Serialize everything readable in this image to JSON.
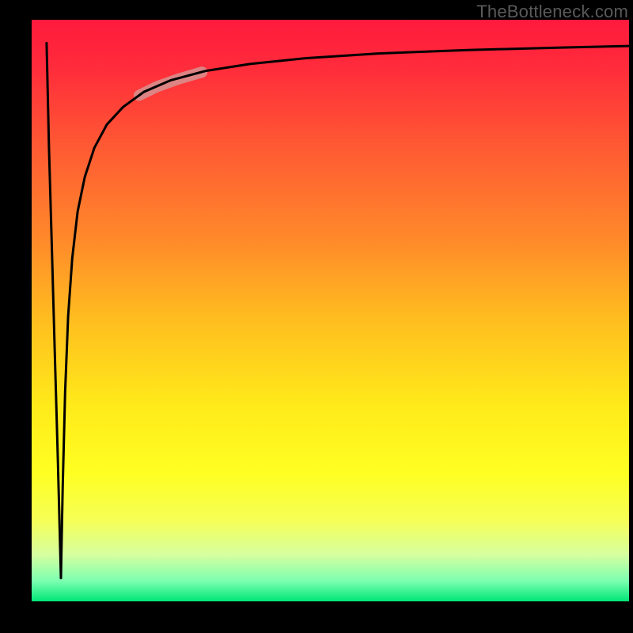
{
  "watermark": "TheBottleneck.com",
  "chart_data": {
    "type": "line",
    "title": "",
    "xlabel": "",
    "ylabel": "",
    "xlim": [
      0,
      100
    ],
    "ylim": [
      0,
      100
    ],
    "gradient": {
      "stops": [
        {
          "pos": 0.0,
          "color": "#ff1a3d"
        },
        {
          "pos": 0.08,
          "color": "#ff2b3b"
        },
        {
          "pos": 0.22,
          "color": "#ff5a33"
        },
        {
          "pos": 0.38,
          "color": "#ff8a2a"
        },
        {
          "pos": 0.52,
          "color": "#ffbf1f"
        },
        {
          "pos": 0.66,
          "color": "#ffe91a"
        },
        {
          "pos": 0.78,
          "color": "#ffff22"
        },
        {
          "pos": 0.86,
          "color": "#f6ff55"
        },
        {
          "pos": 0.92,
          "color": "#d6ffa0"
        },
        {
          "pos": 0.965,
          "color": "#7bffb0"
        },
        {
          "pos": 1.0,
          "color": "#00e676"
        }
      ]
    },
    "series": [
      {
        "name": "down-stroke",
        "stroke": "#000000",
        "width": 3,
        "x": [
          2.5,
          2.9,
          3.4,
          3.9,
          4.4,
          4.9
        ],
        "values": [
          96.0,
          78.0,
          60.0,
          42.0,
          24.0,
          4.0
        ]
      },
      {
        "name": "log-curve",
        "stroke": "#000000",
        "width": 3,
        "x": [
          4.9,
          5.2,
          5.6,
          6.1,
          6.8,
          7.7,
          8.9,
          10.5,
          12.6,
          15.3,
          18.8,
          23.3,
          29.1,
          36.5,
          46.0,
          58.0,
          73.0,
          88.0,
          100.0
        ],
        "values": [
          4.0,
          20.0,
          36.0,
          49.0,
          59.0,
          67.0,
          73.0,
          78.0,
          82.0,
          85.0,
          87.6,
          89.6,
          91.2,
          92.4,
          93.4,
          94.2,
          94.8,
          95.2,
          95.5
        ]
      }
    ],
    "highlight": {
      "name": "pink-segment",
      "stroke": "#d98d8d",
      "width": 14,
      "opacity": 0.9,
      "x": [
        18.0,
        21.0,
        24.5,
        28.5
      ],
      "values": [
        87.0,
        88.5,
        89.8,
        91.0
      ]
    }
  }
}
